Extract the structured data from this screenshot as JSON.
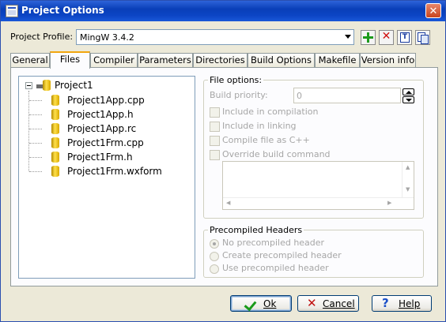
{
  "window": {
    "title": "Project Options"
  },
  "profile": {
    "label": "Project Profile:",
    "value": "MingW 3.4.2"
  },
  "tabs": [
    "General",
    "Files",
    "Compiler",
    "Parameters",
    "Directories",
    "Build Options",
    "Makefile",
    "Version info"
  ],
  "active_tab": "Files",
  "tree": {
    "root": "Project1",
    "files": [
      "Project1App.cpp",
      "Project1App.h",
      "Project1App.rc",
      "Project1Frm.cpp",
      "Project1Frm.h",
      "Project1Frm.wxform"
    ]
  },
  "file_options": {
    "title": "File options:",
    "priority_label": "Build priority:",
    "priority_value": "0",
    "include_compilation": "Include in compilation",
    "include_linking": "Include in linking",
    "compile_cpp": "Compile file as C++",
    "override_build": "Override build command"
  },
  "precompiled": {
    "title": "Precompiled Headers",
    "options": [
      "No precompiled header",
      "Create precompiled header",
      "Use precompiled header"
    ],
    "selected_index": 0
  },
  "buttons": {
    "ok": "Ok",
    "cancel": "Cancel",
    "help": "Help"
  }
}
